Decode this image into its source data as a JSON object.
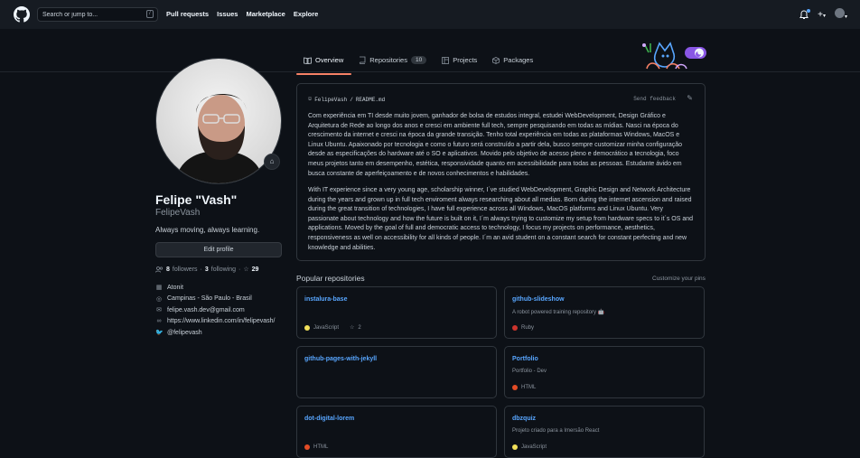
{
  "header": {
    "search_placeholder": "Search or jump to...",
    "slash_key": "/",
    "nav": [
      "Pull requests",
      "Issues",
      "Marketplace",
      "Explore"
    ],
    "icons": {
      "logo": "github-mark-icon",
      "bell": "bell-icon",
      "plus": "plus-icon",
      "avatar": "user-avatar"
    }
  },
  "tabs": [
    {
      "label": "Overview",
      "icon": "book-icon",
      "active": true
    },
    {
      "label": "Repositories",
      "icon": "repo-icon",
      "count": "10"
    },
    {
      "label": "Projects",
      "icon": "project-icon"
    },
    {
      "label": "Packages",
      "icon": "package-icon"
    }
  ],
  "profile": {
    "name": "Felipe \"Vash\"",
    "login": "FelipeVash",
    "bio": "Always moving, always learning.",
    "edit_label": "Edit profile",
    "followers": "8",
    "followers_label": "followers",
    "following": "3",
    "following_label": "following",
    "stars": "29",
    "details": [
      {
        "icon": "organization-icon",
        "text": "Atonit"
      },
      {
        "icon": "location-icon",
        "text": "Campinas - São Paulo - Brasil"
      },
      {
        "icon": "mail-icon",
        "text": "felipe.vash.dev@gmail.com"
      },
      {
        "icon": "link-icon",
        "text": "https://www.linkedin.com/in/felipevash/"
      },
      {
        "icon": "twitter-icon",
        "text": "@felipevash"
      }
    ]
  },
  "readme": {
    "user": "FelipeVash",
    "sep": "/",
    "file": "README.md",
    "send_feedback": "Send feedback",
    "p1": "Com experiência em TI desde muito jovem, ganhador de bolsa de estudos integral, estudei WebDevelopment, Design Gráfico e Arquitetura de Rede ao longo dos anos e cresci em ambiente full tech, sempre pesquisando em todas as mídias. Nasci na época do crescimento da internet e cresci na época da grande transição. Tenho total experiência em todas as plataformas Windows, MacOS e Linux Ubuntu. Apaixonado por tecnologia e como o futuro será construído a partir dela, busco sempre customizar minha configuração desde as especificações do hardware até o SO e aplicativos. Movido pelo objetivo de acesso pleno e democrático a tecnologia, foco meus projetos tanto em desempenho, estética, responsividade quanto em acessibilidade para todas as pessoas. Estudante ávido em busca constante de aperfeiçoamento e de novos conhecimentos e habilidades.",
    "p2": "With IT experience since a very young age, scholarship winner, I´ve studied WebDevelopment, Graphic Design and Network Architecture during the years and grown up in full tech enviroment always researching about all medias. Born during the internet ascension and raised during the great transition of technologies, I have full experience across all Windows, MacOS platforms and Linux Ubuntu. Very passionate about technology and how the future is built on it, I´m always trying to customize my setup from hardware specs to it´s OS and applications. Moved by the goal of full and democratic access to technology, I focus my projects on performance, aesthetics, responsiveness as well on accessibility for all kinds of people. I´m an avid student on a constant search for constant perfecting and new knowledge and abilities."
  },
  "popular": {
    "title": "Popular repositories",
    "customize": "Customize your pins",
    "repos": [
      {
        "name": "instalura-base",
        "desc": "",
        "lang": "JavaScript",
        "color": "#f1e05a",
        "stars": "2"
      },
      {
        "name": "github-slideshow",
        "desc": "A robot powered training repository 🤖",
        "lang": "Ruby",
        "color": "#cc342d",
        "stars": ""
      },
      {
        "name": "github-pages-with-jekyll",
        "desc": "",
        "lang": "",
        "color": "",
        "stars": ""
      },
      {
        "name": "Portfolio",
        "desc": "Portfolio - Dev",
        "lang": "HTML",
        "color": "#e34c26",
        "stars": ""
      },
      {
        "name": "dot-digital-lorem",
        "desc": "",
        "lang": "HTML",
        "color": "#e34c26",
        "stars": ""
      },
      {
        "name": "dbzquiz",
        "desc": "Projeto criado para a Imersão React",
        "lang": "JavaScript",
        "color": "#f1e05a",
        "stars": ""
      }
    ]
  },
  "colors": {
    "bg": "#0d1117",
    "header": "#161b22",
    "border": "#30363d",
    "link": "#58a6ff",
    "tab_accent": "#f78166"
  }
}
